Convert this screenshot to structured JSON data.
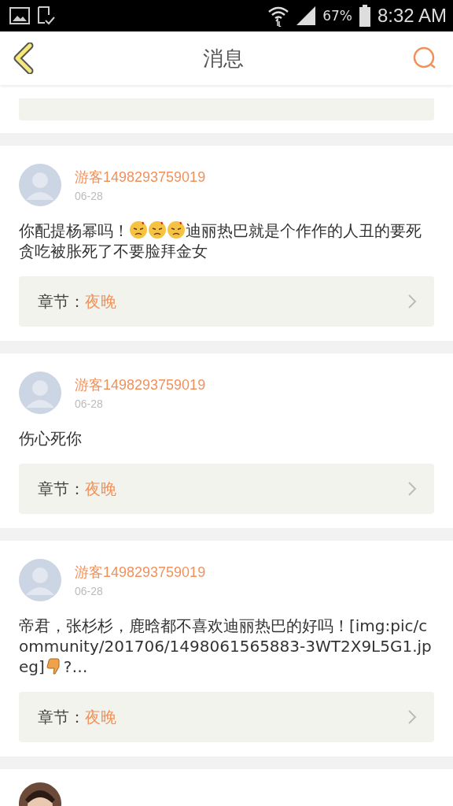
{
  "status_bar": {
    "battery": "67%",
    "time": "8:32 AM"
  },
  "header": {
    "title": "消息"
  },
  "messages": [
    {
      "kind": "cut_top"
    },
    {
      "kind": "full",
      "user": "游客1498293759019",
      "date": "06-28",
      "body": [
        {
          "kind": "text",
          "text": "你配提杨幂吗！"
        },
        {
          "kind": "emoji"
        },
        {
          "kind": "emoji"
        },
        {
          "kind": "emoji"
        },
        {
          "kind": "text",
          "text": "迪丽热巴就是个作作的人丑的要死贪吃被胀死了不要脸拜金女"
        }
      ],
      "chapter_label": "章节：",
      "chapter": "夜晚"
    },
    {
      "kind": "full",
      "user": "游客1498293759019",
      "date": "06-28",
      "body": [
        {
          "kind": "text",
          "text": "伤心死你"
        }
      ],
      "chapter_label": "章节：",
      "chapter": "夜晚"
    },
    {
      "kind": "full",
      "user": "游客1498293759019",
      "date": "06-28",
      "body": [
        {
          "kind": "text",
          "text": "帝君，张杉杉，鹿晗都不喜欢迪丽热巴的好吗！[img:pic/community/201706/1498061565883-3WT2X9L5G1.jpeg]"
        },
        {
          "kind": "thumb"
        },
        {
          "kind": "text",
          "text": "?…"
        }
      ],
      "chapter_label": "章节：",
      "chapter": "夜晚"
    },
    {
      "kind": "cut_bottom"
    }
  ]
}
